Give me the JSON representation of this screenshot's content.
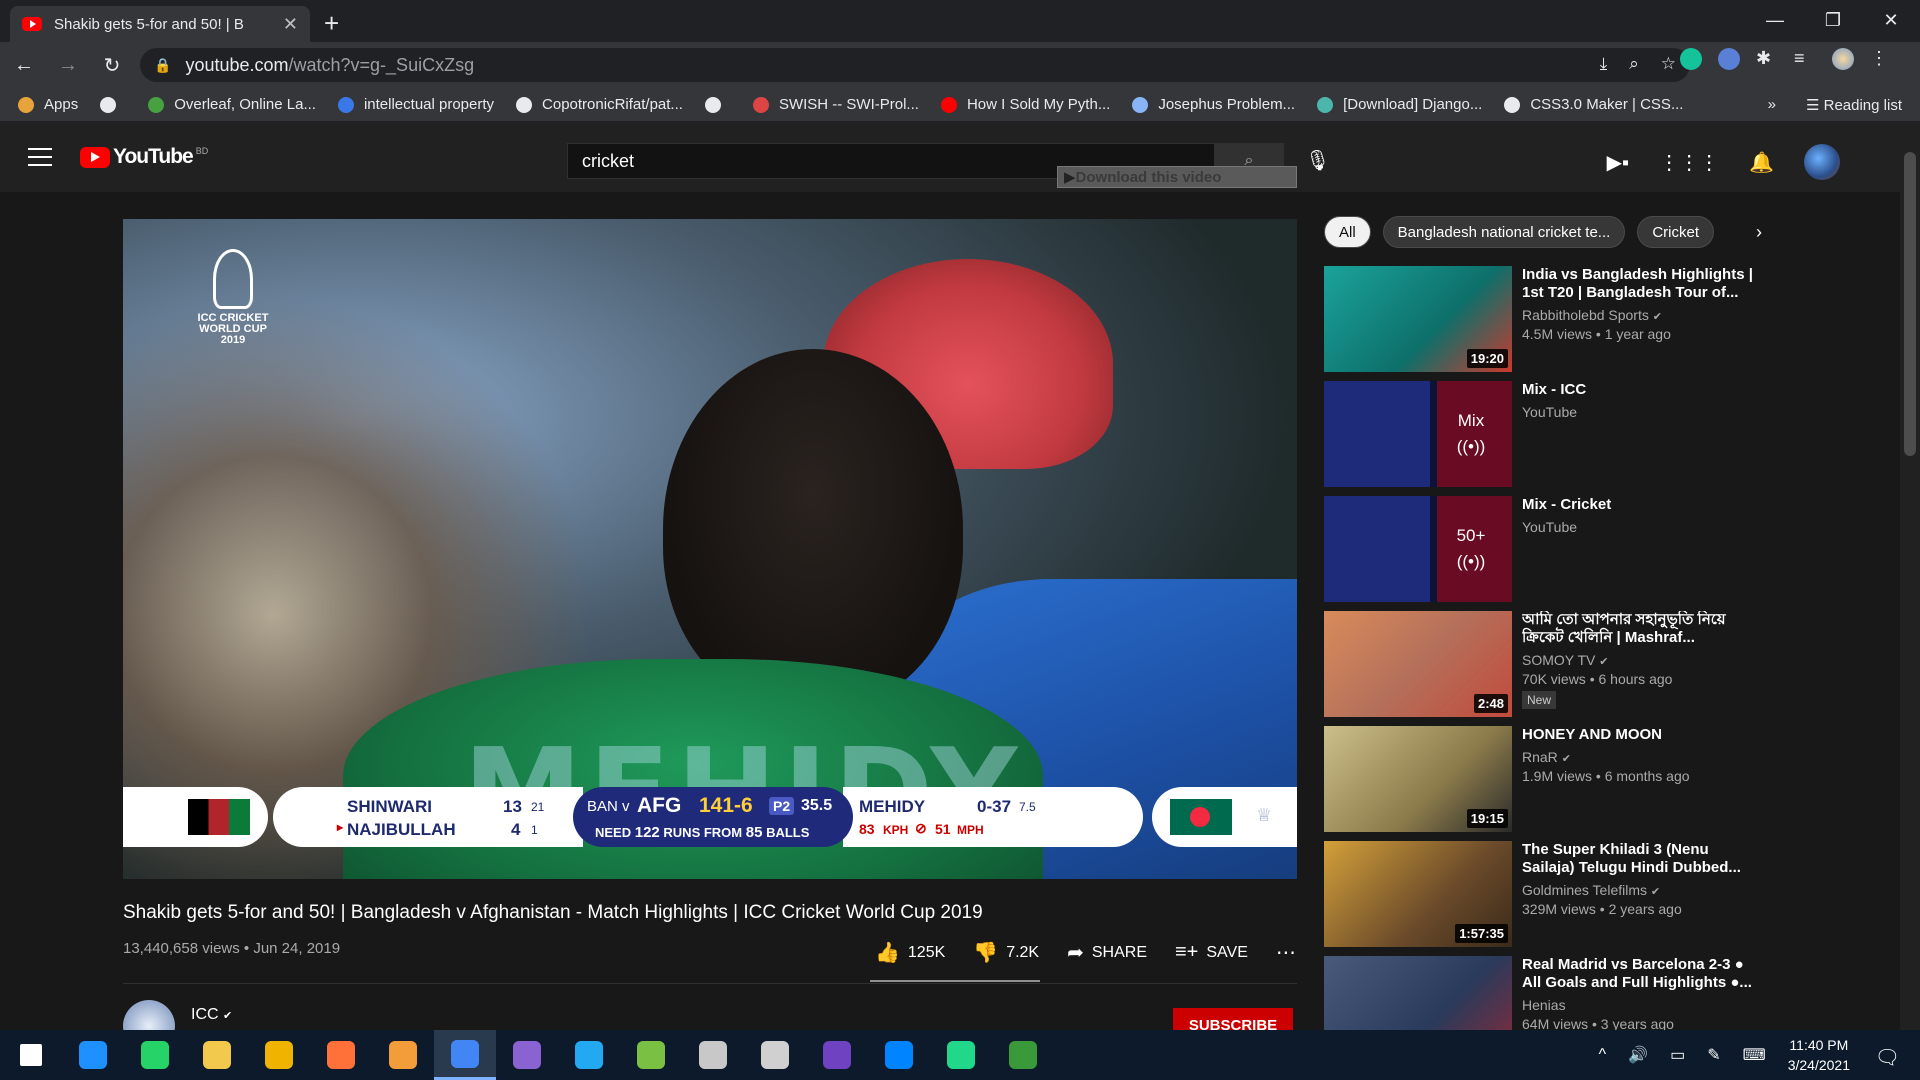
{
  "browser": {
    "tab_title": "Shakib gets 5-for and 50! | B",
    "url_host": "youtube.com",
    "url_path": "/watch?v=g-_SuiCxZsg",
    "bookmarks": [
      {
        "label": "Apps",
        "color": "#e8a33a"
      },
      {
        "label": "",
        "color": "#e8eaed"
      },
      {
        "label": "Overleaf, Online La...",
        "color": "#47a141"
      },
      {
        "label": "intellectual property",
        "color": "#3b78e7"
      },
      {
        "label": "CopotronicRifat/pat...",
        "color": "#e8eaed"
      },
      {
        "label": "",
        "color": "#e8eaed"
      },
      {
        "label": "SWISH -- SWI-Prol...",
        "color": "#d44"
      },
      {
        "label": "How I Sold My Pyth...",
        "color": "#ff0000"
      },
      {
        "label": "Josephus Problem...",
        "color": "#8ab4f8"
      },
      {
        "label": "[Download] Django...",
        "color": "#4db6ac"
      },
      {
        "label": "CSS3.0 Maker | CSS...",
        "color": "#e8eaed"
      }
    ],
    "overflow": "»",
    "reading_list": "Reading list"
  },
  "youtube": {
    "logo_text": "YouTube",
    "country": "BD",
    "search_value": "cricket",
    "download_label": "Download this video",
    "video": {
      "title": "Shakib gets 5-for and 50! | Bangladesh v Afghanistan - Match Highlights | ICC Cricket World Cup 2019",
      "meta": "13,440,658 views • Jun 24, 2019",
      "likes": "125K",
      "dislikes": "7.2K",
      "share": "SHARE",
      "save": "SAVE",
      "channel": "ICC",
      "subscribe": "SUBSCRIBE"
    },
    "overlay": {
      "cwc_text": "ICC CRICKET WORLD CUP 2019",
      "jersey": "MEHIDY",
      "bat1_name": "SHINWARI",
      "bat1_runs": "13",
      "bat1_balls": "21",
      "bat2_name": "NAJIBULLAH",
      "bat2_runs": "4",
      "bat2_balls": "1",
      "match": "BAN v",
      "team": "AFG",
      "score": "141-6",
      "powerplay": "P2",
      "overs": "35.5",
      "need": "NEED",
      "need_runs": "122",
      "runs_from": "RUNS FROM",
      "balls": "85",
      "balls_label": "BALLS",
      "bowler": "MEHIDY",
      "bowler_figures": "0-37",
      "bowler_overs": "7.5",
      "speed_kph": "83",
      "kph": "KPH",
      "speed_mph": "51",
      "mph": "MPH"
    },
    "chips": [
      "All",
      "Bangladesh national cricket te...",
      "Cricket"
    ],
    "recommendations": [
      {
        "title": "India vs Bangladesh Highlights | 1st T20 | Bangladesh Tour of...",
        "channel": "Rabbitholebd Sports",
        "verified": true,
        "meta": "4.5M views • 1 year ago",
        "duration": "19:20",
        "thumb": "linear-gradient(135deg,#1aa39b,#0e6f6a 60%,#c93a2e)"
      },
      {
        "title": "Mix - ICC",
        "channel": "YouTube",
        "verified": false,
        "meta": "",
        "duration": "",
        "mix": "Mix",
        "thumb": "linear-gradient(90deg,#1e2a7a 0 60%,#e8194f 60%)"
      },
      {
        "title": "Mix - Cricket",
        "channel": "YouTube",
        "verified": false,
        "meta": "",
        "duration": "",
        "mix": "50+",
        "thumb": "linear-gradient(90deg,#1e2a7a 0 60%,#e8194f 60%)"
      },
      {
        "title": "আমি তো আপনার সহানুভূতি নিয়ে ক্রিকেট খেলিনি | Mashraf...",
        "channel": "SOMOY TV",
        "verified": true,
        "meta": "70K views • 6 hours ago",
        "duration": "2:48",
        "badge": "New",
        "thumb": "linear-gradient(135deg,#d98b5a,#b4705a 50%,#c24a3c)"
      },
      {
        "title": "HONEY AND MOON",
        "channel": "RnaR",
        "verified": true,
        "meta": "1.9M views • 6 months ago",
        "duration": "19:15",
        "thumb": "linear-gradient(135deg,#cdbf8a,#8a7a4a 60%,#2a2a2a)"
      },
      {
        "title": "The Super Khiladi 3 (Nenu Sailaja) Telugu Hindi Dubbed...",
        "channel": "Goldmines Telefilms",
        "verified": true,
        "meta": "329M views • 2 years ago",
        "duration": "1:57:35",
        "thumb": "linear-gradient(135deg,#d4a03a,#6a4a2a 60%,#3a2a1a)"
      },
      {
        "title": "Real Madrid vs Barcelona 2-3 ● All Goals and Full Highlights ●...",
        "channel": "Henias",
        "verified": false,
        "meta": "64M views • 3 years ago",
        "duration": "",
        "thumb": "linear-gradient(135deg,#4a5a7a,#2a3a5a 60%,#8a2a3a)"
      }
    ]
  },
  "taskbar": {
    "apps": [
      "#ffffff",
      "#1e90ff",
      "#25d366",
      "#f2c94c",
      "#f0b400",
      "#ff7139",
      "#f39c3a",
      "#4285f4",
      "#8a63d2",
      "#23a8f2",
      "#7ac143",
      "#c8c8c8",
      "#d0d0d0",
      "#6f42c1",
      "#0084ff",
      "#21d789",
      "#3a9a3a"
    ],
    "active_index": 7,
    "time": "11:40 PM",
    "date": "3/24/2021"
  }
}
